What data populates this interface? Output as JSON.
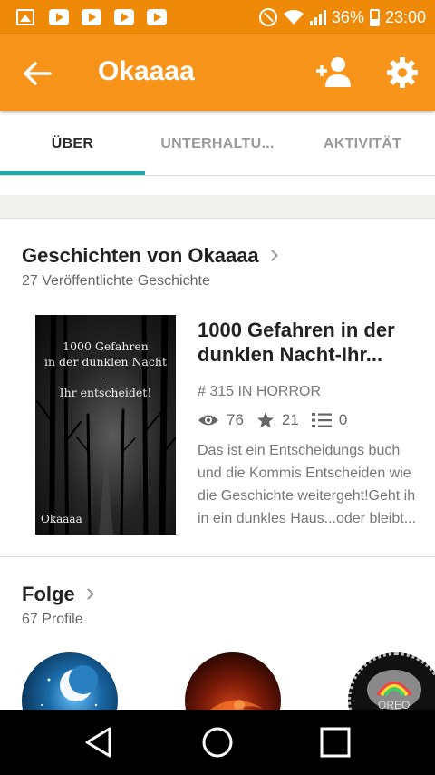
{
  "statusbar": {
    "battery": "36%",
    "time": "23:00"
  },
  "appbar": {
    "title": "Okaaaa"
  },
  "tabs": [
    {
      "label": "ÜBER"
    },
    {
      "label": "UNTERHALTU..."
    },
    {
      "label": "AKTIVITÄT"
    }
  ],
  "stories": {
    "title": "Geschichten von Okaaaa",
    "subtitle": "27 Veröffentlichte Geschichte",
    "items": [
      {
        "cover_title_line1": "1000 Gefahren",
        "cover_title_line2": "in der dunklen Nacht",
        "cover_title_line3": "-",
        "cover_title_line4": "Ihr entscheidet!",
        "cover_author": "Okaaaa",
        "title": "1000 Gefahren in der dunklen Nacht-Ihr...",
        "rank": "# 315 IN HORROR",
        "reads": "76",
        "votes": "21",
        "parts": "0",
        "desc_line1": "Das ist ein Entscheidungs buch",
        "desc_line2": "und die Kommis Entscheiden wie",
        "desc_line3": "die Geschichte weitergeht!Geht ih",
        "desc_line4": "in ein dunkles Haus...oder bleibt..."
      }
    ]
  },
  "follow": {
    "title": "Folge",
    "subtitle": "67 Profile",
    "avatar3_text": "OREO"
  },
  "colors": {
    "statusbar": "#ef8a08",
    "appbar": "#f9941a",
    "tab_indicator": "#1ba8a6"
  }
}
